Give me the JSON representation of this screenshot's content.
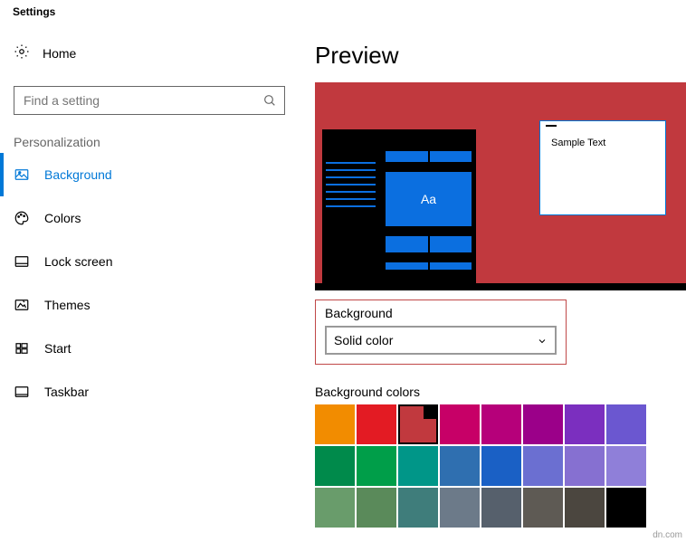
{
  "app": {
    "title": "Settings"
  },
  "sidebar": {
    "home": "Home",
    "search_placeholder": "Find a setting",
    "section": "Personalization",
    "items": [
      {
        "label": "Background"
      },
      {
        "label": "Colors"
      },
      {
        "label": "Lock screen"
      },
      {
        "label": "Themes"
      },
      {
        "label": "Start"
      },
      {
        "label": "Taskbar"
      }
    ]
  },
  "main": {
    "preview_heading": "Preview",
    "sample_text": "Sample Text",
    "tile_letters": "Aa",
    "bg_section": {
      "label": "Background",
      "selected": "Solid color"
    },
    "colors_label": "Background colors",
    "swatches": [
      "#f28c00",
      "#e31b23",
      "#c1393e",
      "#c70067",
      "#b6007a",
      "#9b0089",
      "#7b2fbf",
      "#6b57d0",
      "#008a4b",
      "#009e49",
      "#009688",
      "#2f6fb0",
      "#1a60c5",
      "#6b6fd1",
      "#8670d1",
      "#8f7fd9",
      "#699c6b",
      "#5a8a5a",
      "#3f7d7b",
      "#6c7a89",
      "#56606c",
      "#5e5a54",
      "#4b463f",
      "#000000"
    ],
    "selected_swatch_index": 2
  },
  "watermark": "dn.com"
}
